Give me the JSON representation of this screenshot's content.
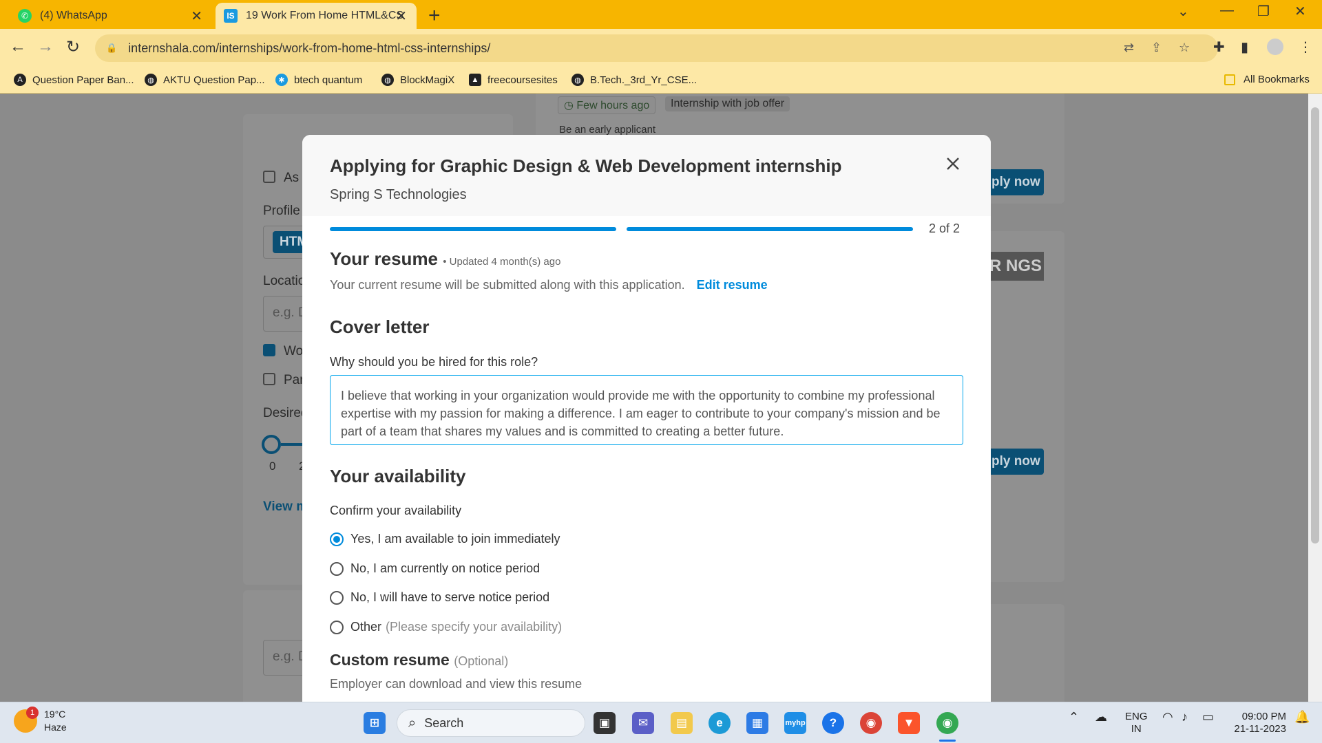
{
  "browser": {
    "tabs": [
      {
        "title": "(4) WhatsApp",
        "active": false
      },
      {
        "title": "19 Work From Home HTML&CS",
        "active": true
      }
    ],
    "url": "internshala.com/internships/work-from-home-html-css-internships/",
    "bookmarks": [
      "Question Paper Ban...",
      "AKTU Question Pap...",
      "btech quantum",
      "BlockMagiX",
      "freecoursesites",
      "B.Tech._3rd_Yr_CSE..."
    ],
    "all_bookmarks_label": "All Bookmarks"
  },
  "background": {
    "filter_checkbox_label": "As",
    "profile_label": "Profile",
    "profile_chip": "HTM",
    "location_label": "Locatio",
    "location_placeholder": "e.g. D",
    "wfh_label": "Wo",
    "parttime_label": "Par",
    "desired_label": "Desired",
    "slider_min": "0",
    "slider_next": "2",
    "view_more": "View m",
    "bottom_placeholder": "e.g. D",
    "posted": "Few hours ago",
    "job_offer_tag": "Internship with job offer",
    "early_applicant": "Be an early applicant",
    "apply_now_1": "ply now",
    "apply_now_2": "ply now",
    "logo_text": "R NGS"
  },
  "modal": {
    "title": "Applying for Graphic Design & Web Development internship",
    "company": "Spring S Technologies",
    "step": "2 of 2",
    "resume_heading": "Your resume",
    "resume_updated": "• Updated 4 month(s) ago",
    "resume_note": "Your current resume will be submitted along with this application.",
    "edit_resume": "Edit resume",
    "cover_heading": "Cover letter",
    "cover_question": "Why should you be hired for this role?",
    "cover_text": "I believe that working in your organization would provide me with the opportunity to combine my professional expertise with my passion for making a difference. I am eager to contribute to your company's mission and be part of a team that shares my values and is committed to creating a better future.",
    "availability_heading": "Your availability",
    "availability_question": "Confirm your availability",
    "availability_options": [
      {
        "label": "Yes, I am available to join immediately",
        "selected": true
      },
      {
        "label": "No, I am currently on notice period",
        "selected": false
      },
      {
        "label": "No, I will have to serve notice period",
        "selected": false
      },
      {
        "label": "Other",
        "hint": "(Please specify your availability)",
        "selected": false
      }
    ],
    "custom_resume_heading": "Custom resume",
    "custom_resume_optional": "(Optional)",
    "custom_resume_note": "Employer can download and view this resume"
  },
  "taskbar": {
    "weather_temp": "19°C",
    "weather_desc": "Haze",
    "weather_badge": "1",
    "search_label": "Search",
    "lang_line1": "ENG",
    "lang_line2": "IN",
    "time": "09:00 PM",
    "date": "21-11-2023"
  },
  "colors": {
    "accent": "#008bdc",
    "chrome": "#f7b500",
    "chrome_light": "#fde8a6"
  }
}
